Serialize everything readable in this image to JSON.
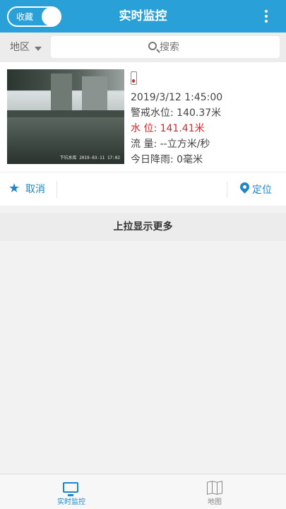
{
  "header": {
    "toggle_label": "收藏",
    "title": "实时监控"
  },
  "filter": {
    "region_label": "地区",
    "search_placeholder": "搜索"
  },
  "station": {
    "image_timestamp": "2019-03-11 17:02",
    "image_watermark": "下坑水库",
    "name": "",
    "time": "2019/3/12 1:45:00",
    "warning_level": "警戒水位: 140.37米",
    "water_level": "水 位: 141.41米",
    "flow": "流 量: --立方米/秒",
    "rainfall": "今日降雨: 0毫米",
    "address": ""
  },
  "actions": {
    "cancel_label": "取消",
    "locate_label": "定位"
  },
  "load_more": "上拉显示更多",
  "tabs": [
    {
      "label": "实时监控",
      "icon": "monitor-icon",
      "active": true
    },
    {
      "label": "地图",
      "icon": "map-icon",
      "active": false
    }
  ],
  "colors": {
    "header": "#2aa0d8",
    "accent": "#1f86c8",
    "alert": "#d9262a"
  }
}
